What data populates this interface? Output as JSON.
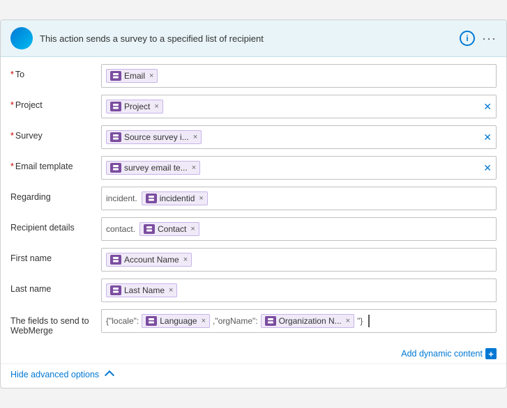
{
  "header": {
    "title": "This action sends a survey to a specified list of recipient",
    "info_icon": "i",
    "more_icon": "···"
  },
  "fields": {
    "to": {
      "label": "To",
      "required": true,
      "tags": [
        {
          "text": "Email",
          "icon": "db"
        }
      ],
      "has_clear": false
    },
    "project": {
      "label": "Project",
      "required": true,
      "tags": [
        {
          "text": "Project",
          "icon": "db"
        }
      ],
      "has_clear": true
    },
    "survey": {
      "label": "Survey",
      "required": true,
      "tags": [
        {
          "text": "Source survey i...",
          "icon": "db"
        }
      ],
      "has_clear": true
    },
    "email_template": {
      "label": "Email template",
      "required": true,
      "tags": [
        {
          "text": "survey email te...",
          "icon": "db"
        }
      ],
      "has_clear": true
    },
    "regarding": {
      "label": "Regarding",
      "required": false,
      "prefix": "incident.",
      "tags": [
        {
          "text": "incidentid",
          "icon": "db"
        }
      ],
      "has_clear": false
    },
    "recipient_details": {
      "label": "Recipient details",
      "required": false,
      "prefix": "contact.",
      "tags": [
        {
          "text": "Contact",
          "icon": "db"
        }
      ],
      "has_clear": false
    },
    "first_name": {
      "label": "First name",
      "required": false,
      "tags": [
        {
          "text": "Account Name",
          "icon": "db"
        }
      ],
      "has_clear": false
    },
    "last_name": {
      "label": "Last name",
      "required": false,
      "tags": [
        {
          "text": "Last Name",
          "icon": "db"
        }
      ],
      "has_clear": false
    },
    "webmerge": {
      "label": "The fields to send to WebMerge",
      "required": false,
      "prefix1": "{\"locale\":",
      "tags1": [
        {
          "text": "Language",
          "icon": "db"
        }
      ],
      "middle_text": ",\"orgName\":",
      "tags2": [
        {
          "text": "Organization N...",
          "icon": "db"
        }
      ],
      "suffix": "\"}"
    }
  },
  "actions": {
    "add_dynamic_content": "Add dynamic content"
  },
  "footer": {
    "hide_label": "Hide advanced options"
  }
}
